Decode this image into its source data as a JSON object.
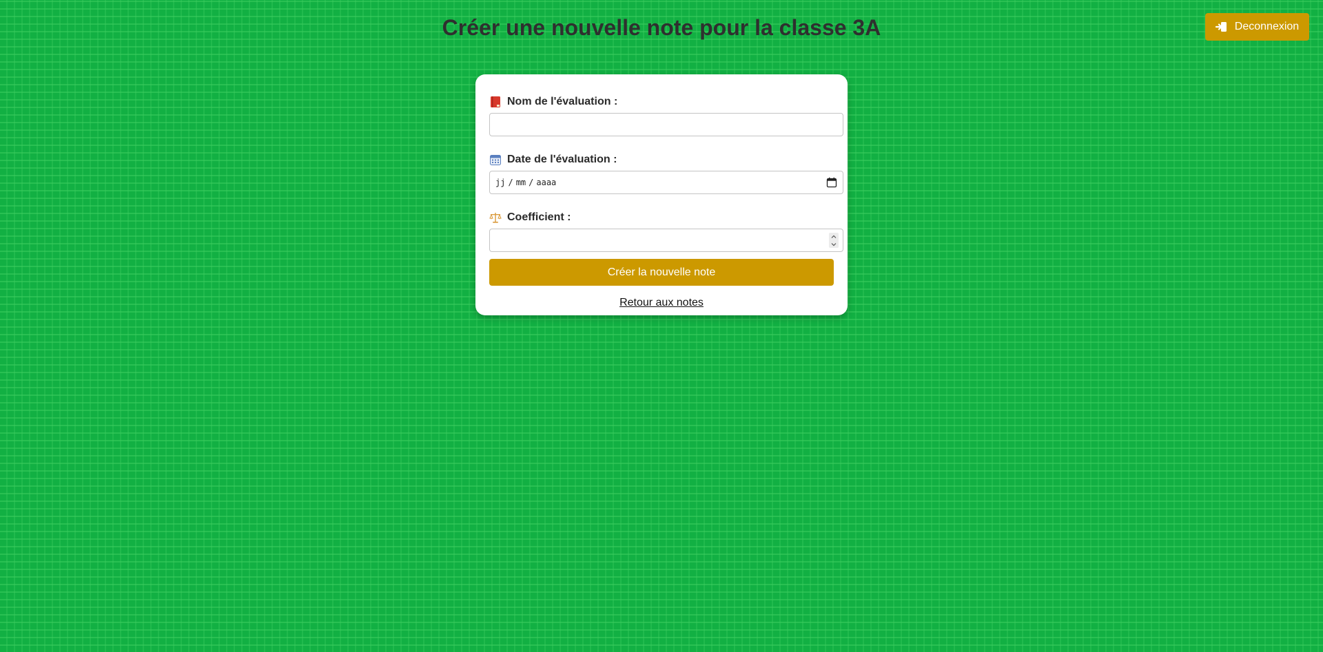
{
  "header": {
    "title": "Créer une nouvelle note pour la classe 3A",
    "logout_label": "Deconnexion"
  },
  "form": {
    "name_label": "Nom de l'évaluation :",
    "name_value": "",
    "date_label": "Date de l'évaluation :",
    "date_placeholder": {
      "day": "jj",
      "month": "mm",
      "year": "aaaa",
      "separator": "/"
    },
    "coef_label": "Coefficient :",
    "coef_value": "",
    "submit_label": "Créer la nouvelle note",
    "back_label": "Retour aux notes"
  },
  "icons": {
    "logout": "logout-icon",
    "name": "book-icon",
    "date": "calendar-icon",
    "coef": "scales-icon",
    "date_picker": "calendar-picker-icon",
    "stepper": "number-stepper"
  },
  "colors": {
    "background": "#12b043",
    "accent": "#cc9900",
    "card": "#ffffff",
    "title": "#2f2f2f"
  }
}
